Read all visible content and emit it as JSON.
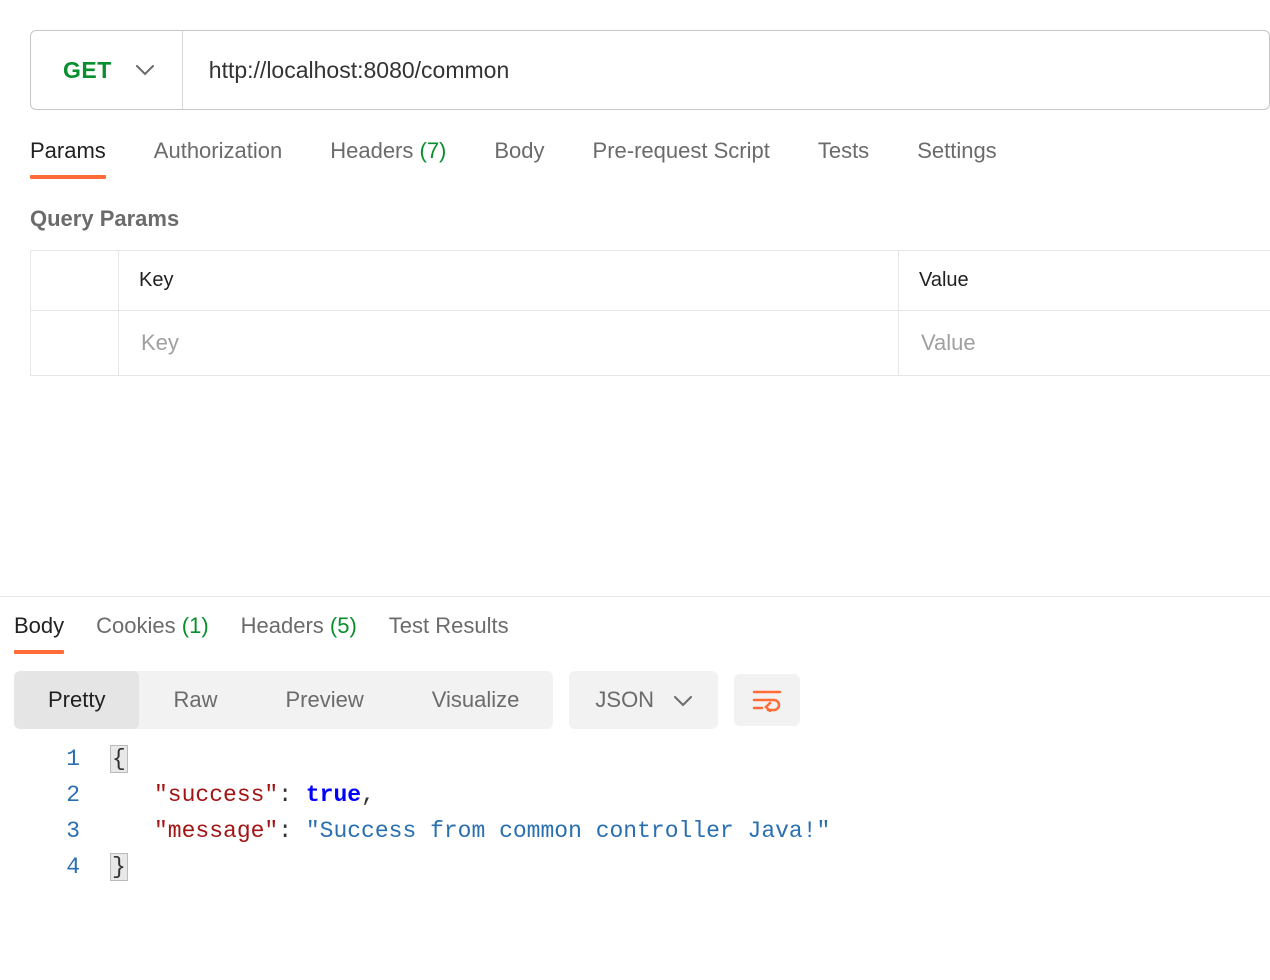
{
  "request": {
    "method": "GET",
    "url": "http://localhost:8080/common",
    "tabs": [
      {
        "label": "Params",
        "count": null
      },
      {
        "label": "Authorization",
        "count": null
      },
      {
        "label": "Headers",
        "count": "(7)"
      },
      {
        "label": "Body",
        "count": null
      },
      {
        "label": "Pre-request Script",
        "count": null
      },
      {
        "label": "Tests",
        "count": null
      },
      {
        "label": "Settings",
        "count": null
      }
    ],
    "active_tab": "Params",
    "section_title": "Query Params",
    "params_headers": {
      "key": "Key",
      "value": "Value"
    },
    "params_placeholders": {
      "key": "Key",
      "value": "Value"
    }
  },
  "response": {
    "tabs": [
      {
        "label": "Body",
        "count": null
      },
      {
        "label": "Cookies",
        "count": "(1)"
      },
      {
        "label": "Headers",
        "count": "(5)"
      },
      {
        "label": "Test Results",
        "count": null
      }
    ],
    "active_tab": "Body",
    "view_modes": [
      "Pretty",
      "Raw",
      "Preview",
      "Visualize"
    ],
    "active_view": "Pretty",
    "format_label": "JSON",
    "json_lines": [
      {
        "n": "1",
        "tokens": [
          {
            "t": "brace",
            "v": "{"
          }
        ]
      },
      {
        "n": "2",
        "tokens": [
          {
            "t": "indent"
          },
          {
            "t": "key",
            "v": "\"success\""
          },
          {
            "t": "punc",
            "v": ": "
          },
          {
            "t": "bool",
            "v": "true"
          },
          {
            "t": "punc",
            "v": ","
          }
        ]
      },
      {
        "n": "3",
        "tokens": [
          {
            "t": "indent"
          },
          {
            "t": "key",
            "v": "\"message\""
          },
          {
            "t": "punc",
            "v": ": "
          },
          {
            "t": "string",
            "v": "\"Success from common controller Java!\""
          }
        ]
      },
      {
        "n": "4",
        "tokens": [
          {
            "t": "brace",
            "v": "}"
          }
        ]
      }
    ]
  }
}
